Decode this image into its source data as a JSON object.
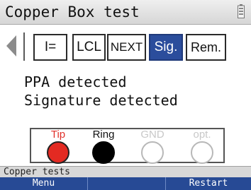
{
  "header": {
    "title": "Copper Box test",
    "icon": "battery-icon"
  },
  "tabs": [
    {
      "label": "I=",
      "active": false
    },
    {
      "label": "LCL",
      "active": false
    },
    {
      "label": "NEXT",
      "active": false
    },
    {
      "label": "Sig.",
      "active": true
    },
    {
      "label": "Rem.",
      "active": false
    }
  ],
  "messages": [
    "PPA detected",
    "Signature detected"
  ],
  "wires": [
    {
      "label": "Tip",
      "label_color": "#e0302a",
      "fill": "#e32a22",
      "stroke": "#222222"
    },
    {
      "label": "Ring",
      "label_color": "#111111",
      "fill": "#000000",
      "stroke": "#000000"
    },
    {
      "label": "GND",
      "label_color": "#c8c8c8",
      "fill": "#ffffff",
      "stroke": "#b8b8b8"
    },
    {
      "label": "opt.",
      "label_color": "#c8c8c8",
      "fill": "#ffffff",
      "stroke": "#b8b8b8"
    }
  ],
  "status": {
    "text": "Copper tests"
  },
  "softkeys": [
    "Menu",
    "",
    "Restart"
  ],
  "colors": {
    "accent": "#2b4d9c",
    "softkey_bar": "#274a95"
  }
}
